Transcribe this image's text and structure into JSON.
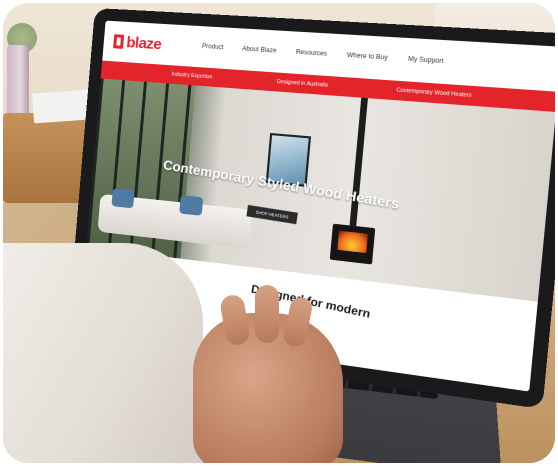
{
  "site": {
    "logo_text": "blaze",
    "nav": [
      "Product",
      "About Blaze",
      "Resources",
      "Where to Buy",
      "My Support"
    ],
    "promo": [
      "Industry Expertise",
      "Designed in Australia",
      "Contemporary Wood Heaters"
    ],
    "hero_title": "Contemporary Styled Wood Heaters",
    "hero_button": "SHOP HEATERS",
    "section_heading": "Designed for modern"
  },
  "colors": {
    "brand_red": "#e3242b",
    "laptop_body": "#1a1a1c",
    "table_wood": "#c9a272"
  },
  "icons": [
    "search-icon",
    "logo-icon"
  ]
}
